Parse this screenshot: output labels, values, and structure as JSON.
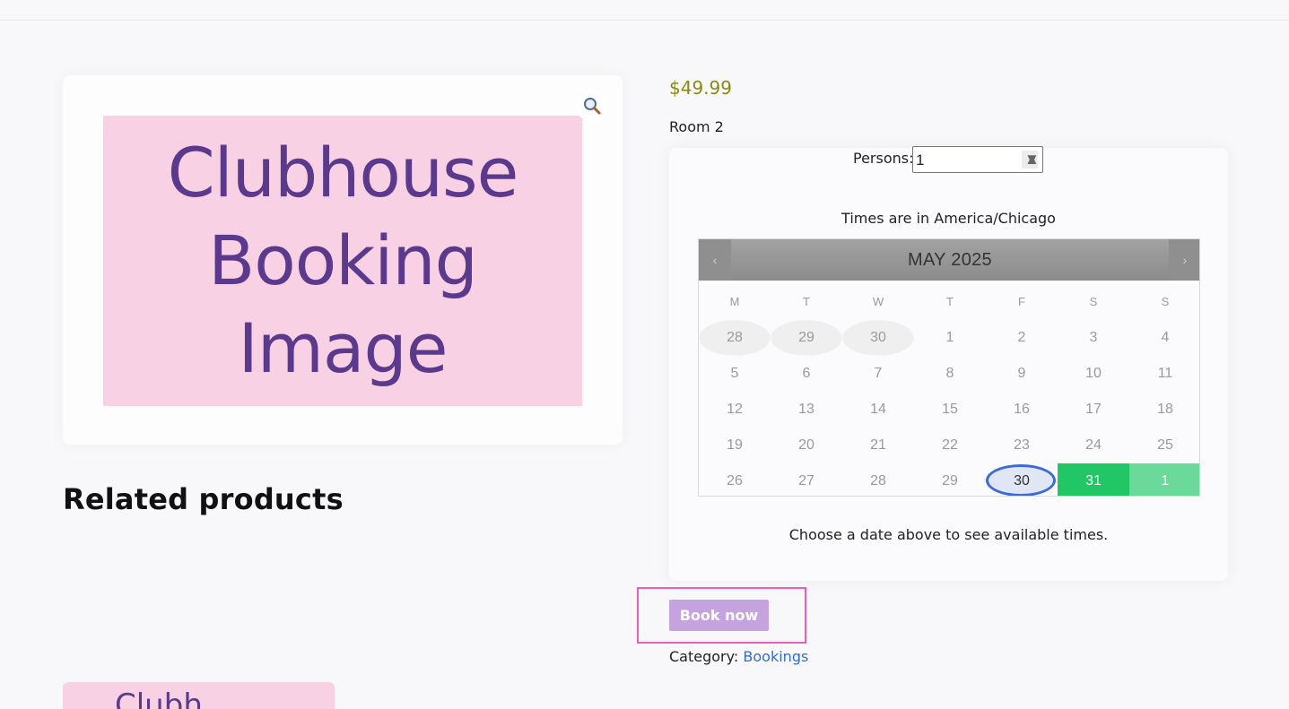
{
  "product": {
    "image_text": [
      "Clubhouse",
      "Booking",
      "Image"
    ],
    "price": "$49.99",
    "name": "Room 2",
    "zoom_icon": "magnifier-icon"
  },
  "booking": {
    "persons_label": "Persons:",
    "persons_value": "1",
    "timezone_note": "Times are in America/Chicago",
    "choose_note": "Choose a date above to see available times.",
    "book_label": "Book now"
  },
  "calendar": {
    "title": "MAY 2025",
    "prev": "‹",
    "next": "›",
    "weekdays": [
      "M",
      "T",
      "W",
      "T",
      "F",
      "S",
      "S"
    ],
    "weeks": [
      [
        "28",
        "29",
        "30",
        "1",
        "2",
        "3",
        "4"
      ],
      [
        "5",
        "6",
        "7",
        "8",
        "9",
        "10",
        "11"
      ],
      [
        "12",
        "13",
        "14",
        "15",
        "16",
        "17",
        "18"
      ],
      [
        "19",
        "20",
        "21",
        "22",
        "23",
        "24",
        "25"
      ],
      [
        "26",
        "27",
        "28",
        "29",
        "30",
        "31",
        "1"
      ]
    ],
    "today": "30",
    "available": [
      "31",
      "1"
    ],
    "colors": {
      "available": "#22c765",
      "today_ring": "#3a6bd8",
      "header": "#999999"
    }
  },
  "related": {
    "heading": "Related products",
    "card_text": "Clubh"
  },
  "category": {
    "label": "Category:",
    "link": "Bookings"
  },
  "colors": {
    "price": "#8a8a12",
    "book_button": "#c4a3df",
    "highlight": "#ea5fbd",
    "link": "#2f6fd1"
  }
}
